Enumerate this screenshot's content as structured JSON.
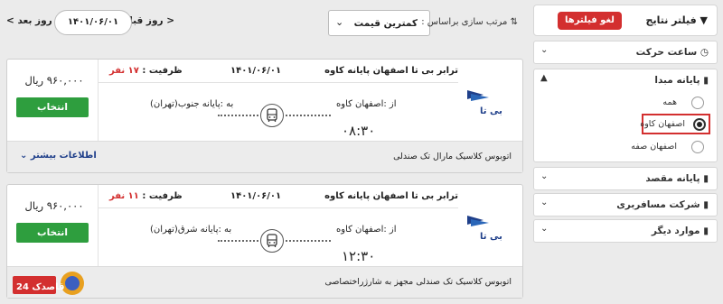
{
  "sidebar": {
    "filter_title": "فیلتر نتایج",
    "clear_filters": "لغو فیلترها",
    "sections": {
      "departure_time": "ساعت حرکت",
      "origin_terminal": "پایانه مبدا",
      "destination_terminal": "پایانه مقصد",
      "bus_company": "شرکت مسافربری",
      "other": "موارد دیگر"
    },
    "origin_options": [
      "همه",
      "اصفهان کاوه",
      "اصفهان صفه"
    ],
    "selected_option": "اصفهان کاوه"
  },
  "topbar": {
    "prev_day": "روز قبل",
    "date": "۱۴۰۱/۰۶/۰۱",
    "next_day": "روز بعد",
    "sort_label": "مرتب سازی براساس :",
    "sort_value": "کمترین قیمت"
  },
  "trips": [
    {
      "route": "ترابر بی تا اصفهان پایانه کاوه",
      "date": "۱۴۰۱/۰۶/۰۱",
      "capacity_label": "ظرفیت :",
      "capacity": "۱۷ نفر",
      "origin": "از :اصفهان کاوه",
      "destination": "به :پایانه جنوب(تهران)",
      "time": "۰۸:۳۰",
      "price": "۹۶۰,۰۰۰ ریال",
      "select": "انتخاب",
      "bus_type": "اتوبوس کلاسیک مارال تک صندلی",
      "more_info": "اطلاعات بیشتر"
    },
    {
      "route": "ترابر بی تا اصفهان پایانه کاوه",
      "date": "۱۴۰۱/۰۶/۰۱",
      "capacity_label": "ظرفیت :",
      "capacity": "۱۱ نفر",
      "origin": "از :اصفهان کاوه",
      "destination": "به :پایانه شرق(تهران)",
      "time": "۱۲:۳۰",
      "price": "۹۶۰,۰۰۰ ریال",
      "select": "انتخاب",
      "bus_type": "اتوبوس کلاسیک تک صندلی مجهز به شارژراختصاصی"
    }
  ],
  "logo_text": "بی تا",
  "watermark": "قاصدک 24",
  "colors": {
    "accent_red": "#d32f2f",
    "select_green": "#2e9e3e",
    "link_blue": "#1f3f8a"
  }
}
